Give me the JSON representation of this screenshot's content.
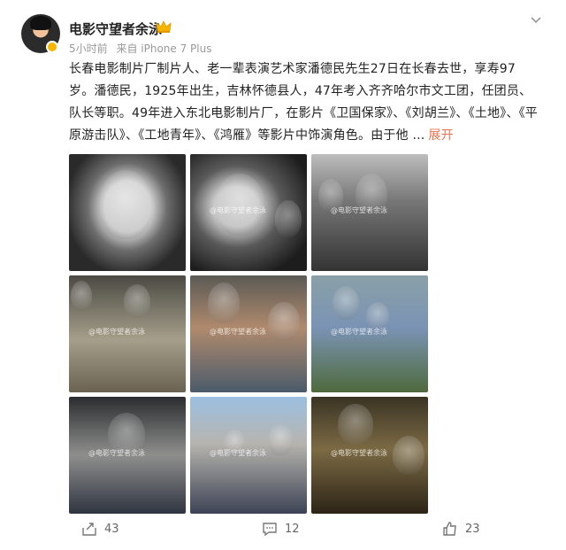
{
  "author": {
    "name": "电影守望者余泳",
    "time": "5小时前",
    "source": "来自 iPhone 7 Plus"
  },
  "post": {
    "text": "长春电影制片厂制片人、老一辈表演艺术家潘德民先生27日在长春去世，享寿97岁。潘德民，1925年出生，吉林怀德县人，47年考入齐齐哈尔市文工团，任团员、队长等职。49年进入东北电影制片厂，在影片《卫国保家》、《刘胡兰》、《土地》、《平原游击队》、《工地青年》、《鸿雁》等影片中饰演角色。由于他 ...",
    "expand_label": "展开"
  },
  "images": {
    "watermark": "@电影守望者余泳",
    "count": 9
  },
  "actions": {
    "share_count": "43",
    "comment_count": "12",
    "like_count": "23"
  },
  "icons": {
    "crown": "crown-icon",
    "chevron": "chevron-down-icon",
    "share": "share-icon",
    "comment": "comment-icon",
    "like": "thumbs-up-icon"
  },
  "colors": {
    "accent": "#eb7350",
    "badge": "#f7b500",
    "meta": "#999999"
  }
}
